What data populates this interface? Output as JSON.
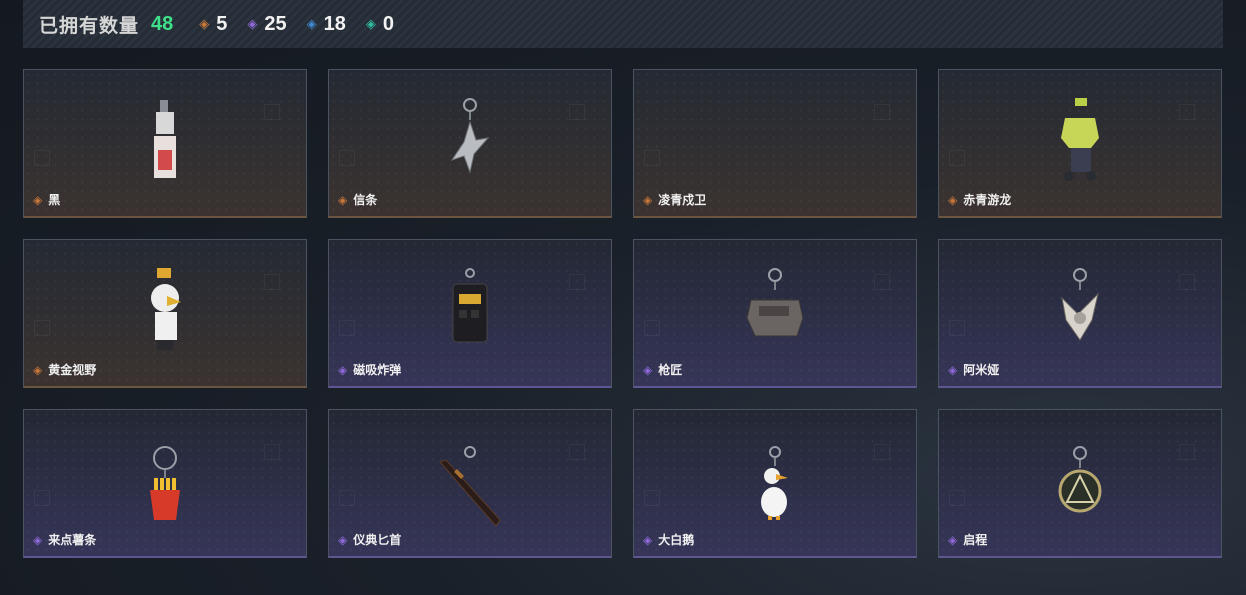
{
  "header": {
    "owned_label": "已拥有数量",
    "owned_count": "48",
    "stats": [
      {
        "icon": "orange-diamond-icon",
        "color": "#c8773a",
        "value": "5"
      },
      {
        "icon": "purple-diamond-icon",
        "color": "#8e6ad8",
        "value": "25"
      },
      {
        "icon": "blue-diamond-icon",
        "color": "#3f8ad0",
        "value": "18"
      },
      {
        "icon": "green-diamond-icon",
        "color": "#2fbfa0",
        "value": "0"
      }
    ]
  },
  "cards": [
    {
      "label": "黑",
      "rarity": "orange",
      "gem_color": "#c8773a"
    },
    {
      "label": "信条",
      "rarity": "orange",
      "gem_color": "#c8773a"
    },
    {
      "label": "凌青戍卫",
      "rarity": "orange",
      "gem_color": "#c8773a"
    },
    {
      "label": "赤青游龙",
      "rarity": "orange",
      "gem_color": "#c8773a"
    },
    {
      "label": "黄金视野",
      "rarity": "orange",
      "gem_color": "#c8773a"
    },
    {
      "label": "磁吸炸弹",
      "rarity": "purple",
      "gem_color": "#8e6ad8"
    },
    {
      "label": "枪匠",
      "rarity": "purple",
      "gem_color": "#8e6ad8"
    },
    {
      "label": "阿米娅",
      "rarity": "purple",
      "gem_color": "#8e6ad8"
    },
    {
      "label": "来点薯条",
      "rarity": "purple",
      "gem_color": "#8e6ad8"
    },
    {
      "label": "仪典匕首",
      "rarity": "purple",
      "gem_color": "#8e6ad8"
    },
    {
      "label": "大白鹅",
      "rarity": "purple",
      "gem_color": "#8e6ad8"
    },
    {
      "label": "启程",
      "rarity": "purple",
      "gem_color": "#8e6ad8"
    }
  ]
}
